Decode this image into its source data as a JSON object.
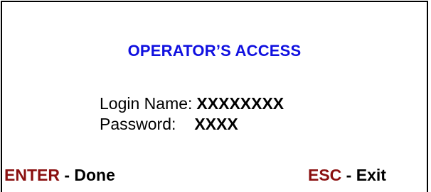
{
  "title": "OPERATOR’S ACCESS",
  "fields": {
    "login_label": "Login Name:",
    "login_value": "XXXXXXXX",
    "password_label": "Password:",
    "password_value": "XXXX"
  },
  "footer": {
    "enter_key": "ENTER",
    "enter_action": " - Done",
    "esc_key": "ESC",
    "esc_action": " - Exit"
  },
  "colors": {
    "title": "#1010e0",
    "key": "#8a1010",
    "text": "#000000"
  }
}
